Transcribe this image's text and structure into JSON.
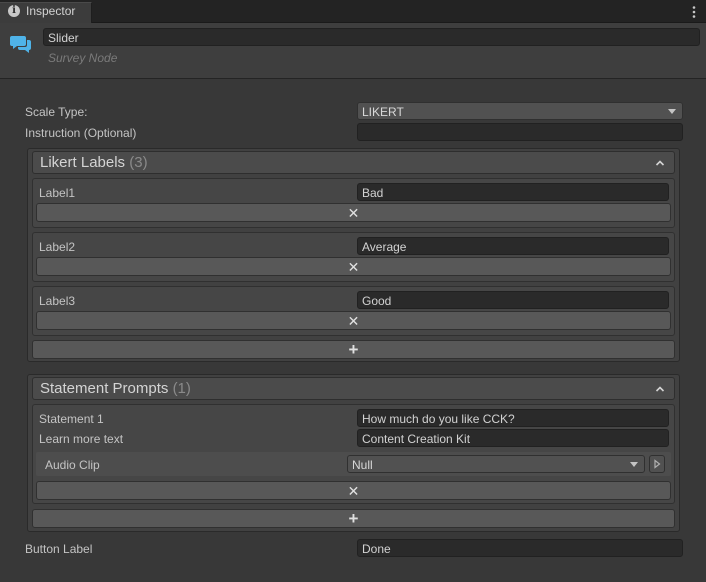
{
  "tab": {
    "label": "Inspector",
    "info_glyph": "i",
    "menu_glyph": "⋮"
  },
  "header": {
    "name": "Slider",
    "subtitle": "Survey Node",
    "icon": "chat-bubbles-icon"
  },
  "scale_type": {
    "label": "Scale Type:",
    "value": "LIKERT"
  },
  "instruction": {
    "label": "Instruction (Optional)",
    "value": ""
  },
  "likert": {
    "title": "Likert Labels",
    "count": "(3)",
    "items": [
      {
        "label": "Label1",
        "value": "Bad"
      },
      {
        "label": "Label2",
        "value": "Average"
      },
      {
        "label": "Label3",
        "value": "Good"
      }
    ]
  },
  "statements": {
    "title": "Statement Prompts",
    "count": "(1)",
    "item": {
      "statement_label": "Statement 1",
      "statement_value": "How much do you like CCK?",
      "learn_label": "Learn more text",
      "learn_value": "Content Creation Kit",
      "audio_label": "Audio Clip",
      "audio_value": "Null"
    }
  },
  "button_label": {
    "label": "Button Label",
    "value": "Done"
  },
  "glyphs": {
    "remove": "✕",
    "add": "+"
  },
  "colors": {
    "background": "#383838",
    "field": "#2a2a2a",
    "accent_icon": "#4fb3e8"
  }
}
